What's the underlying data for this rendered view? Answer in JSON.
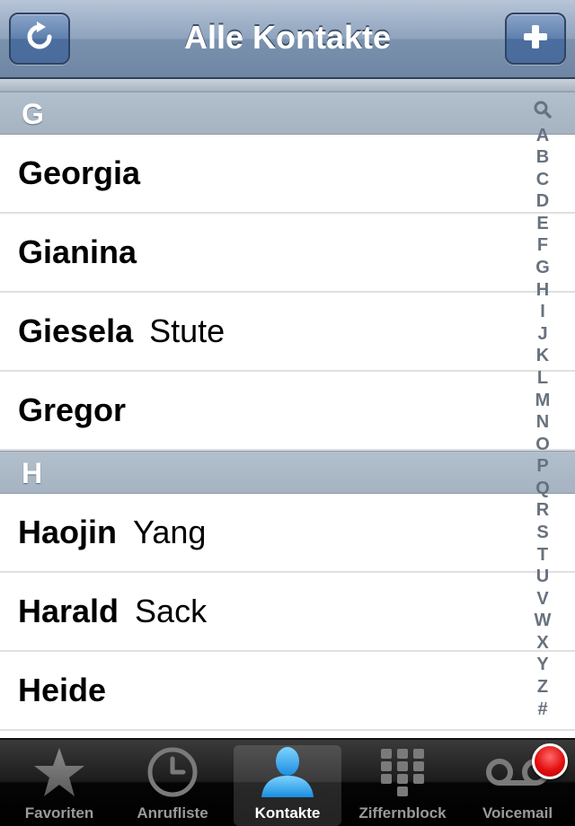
{
  "navbar": {
    "title": "Alle Kontakte",
    "left_button_icon": "refresh-icon",
    "right_button_icon": "plus-icon"
  },
  "sections": [
    {
      "letter": "G",
      "contacts": [
        {
          "first": "Georgia",
          "last": ""
        },
        {
          "first": "Gianina",
          "last": ""
        },
        {
          "first": "Giesela",
          "last": "Stute"
        },
        {
          "first": "Gregor",
          "last": ""
        }
      ]
    },
    {
      "letter": "H",
      "contacts": [
        {
          "first": "Haojin",
          "last": "Yang"
        },
        {
          "first": "Harald",
          "last": "Sack"
        },
        {
          "first": "Heide",
          "last": ""
        }
      ]
    }
  ],
  "index": [
    "A",
    "B",
    "C",
    "D",
    "E",
    "F",
    "G",
    "H",
    "I",
    "J",
    "K",
    "L",
    "M",
    "N",
    "O",
    "P",
    "Q",
    "R",
    "S",
    "T",
    "U",
    "V",
    "W",
    "X",
    "Y",
    "Z",
    "#"
  ],
  "tabbar": {
    "tabs": [
      {
        "label": "Favoriten",
        "icon": "star-icon",
        "active": false
      },
      {
        "label": "Anrufliste",
        "icon": "clock-icon",
        "active": false
      },
      {
        "label": "Kontakte",
        "icon": "person-icon",
        "active": true
      },
      {
        "label": "Ziffernblock",
        "icon": "keypad-icon",
        "active": false
      },
      {
        "label": "Voicemail",
        "icon": "voicemail-icon",
        "active": false,
        "badge": true
      }
    ]
  },
  "colors": {
    "navbar": "#7b92ae",
    "section_header": "#a5b3c2",
    "index_text": "#68727e",
    "active_tab_icon": "#2ea7f2",
    "badge": "#e31010"
  }
}
